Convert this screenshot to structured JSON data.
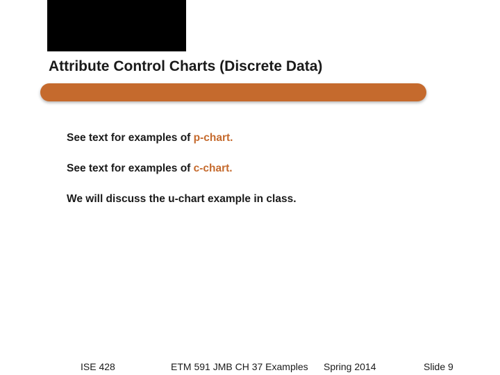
{
  "title": "Attribute Control Charts (Discrete Data)",
  "lines": {
    "l1_prefix": "See text for examples of ",
    "l1_accent": "p-chart.",
    "l2_prefix": "See text for examples of ",
    "l2_accent": "c-chart.",
    "l3": "We will discuss the u-chart example in class."
  },
  "footer": {
    "course": "ISE 428",
    "ext": "ETM 591 JMB   CH 37 Examples",
    "term": "Spring 2014",
    "slide": "Slide 9"
  }
}
